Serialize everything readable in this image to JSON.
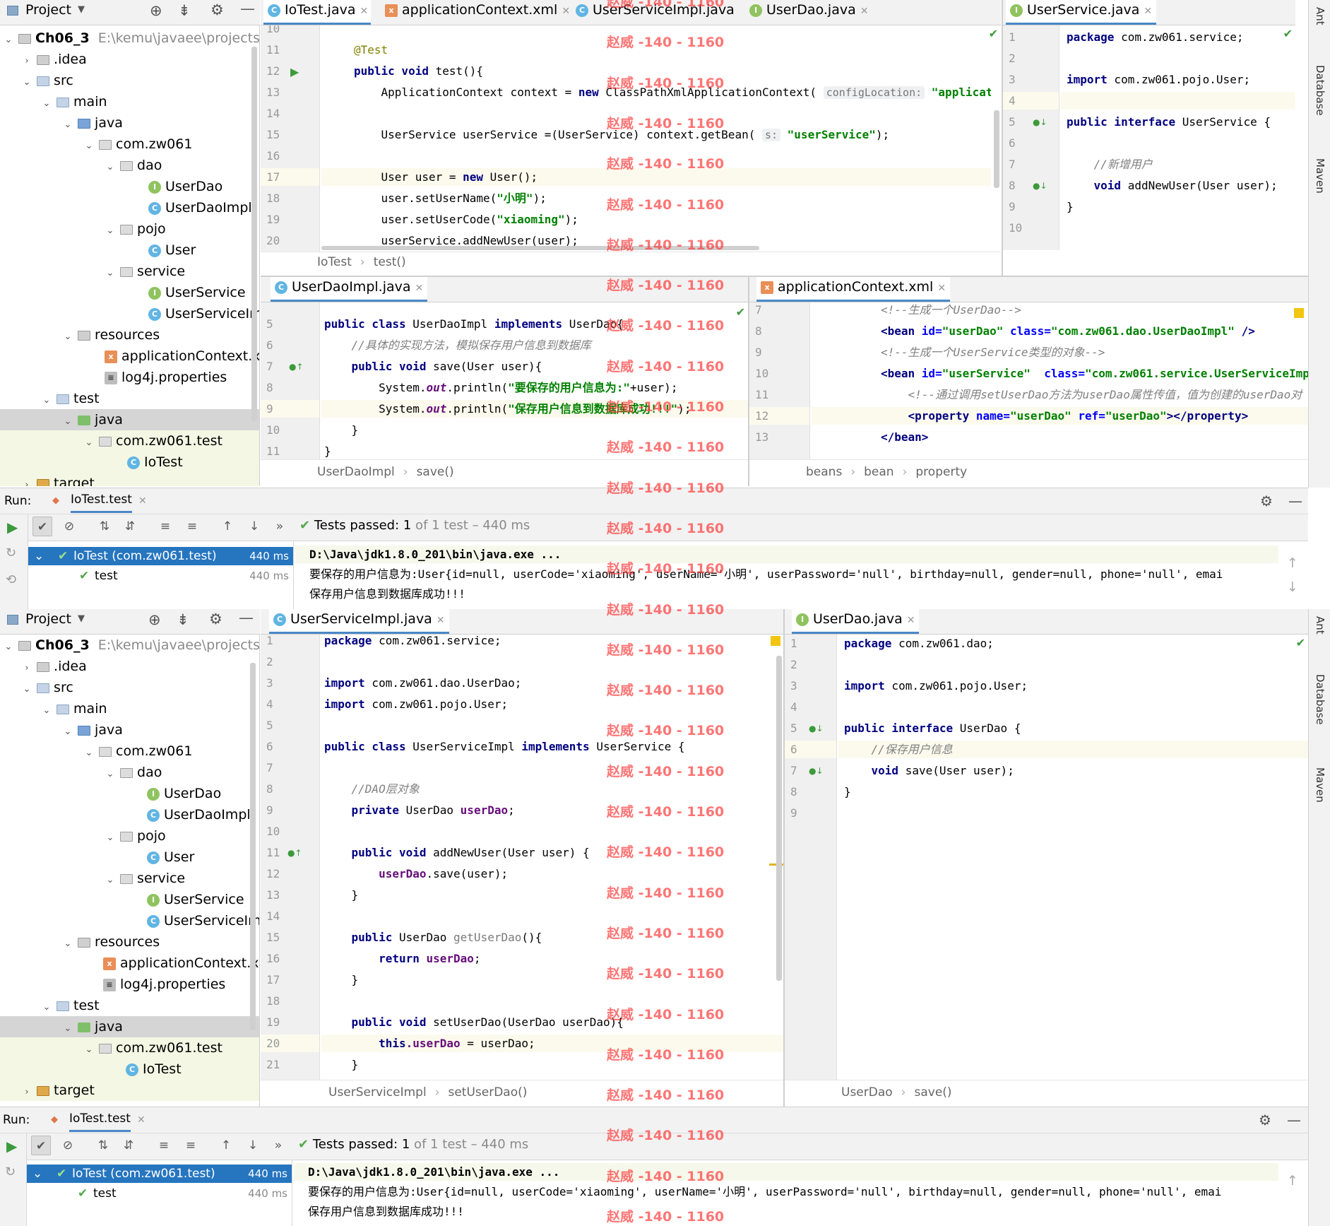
{
  "panel_top": {
    "project": {
      "title": "Project",
      "root_name": "Ch06_3",
      "root_path": "E:\\kemu\\javaee\\projects\\Ch",
      "items": [
        ".idea",
        "src",
        "main",
        "java",
        "com.zw061",
        "dao",
        "UserDao",
        "UserDaoImpl",
        "pojo",
        "User",
        "service",
        "UserService",
        "UserServiceImp",
        "resources",
        "applicationContext.xm",
        "log4j.properties",
        "test",
        "java",
        "com.zw061.test",
        "IoTest",
        "target"
      ]
    },
    "editor_tabs": [
      "IoTest.java",
      "applicationContext.xml",
      "UserServiceImpl.java",
      "UserDao.java"
    ],
    "right_tab": "UserService.java",
    "iotest_lines": {
      "nums": [
        "10",
        "11",
        "12",
        "13",
        "14",
        "15",
        "16",
        "17",
        "18",
        "19",
        "20"
      ],
      "annotation": "@Test",
      "l12_a": "public void ",
      "l12_b": "test(){",
      "l13_a": "    ApplicationContext context = ",
      "l13_kw": "new",
      "l13_b": " ClassPathXmlApplicationContext( ",
      "l13_hint": "configLocation:",
      "l13_str": " \"applicat",
      "l15_a": "    UserService userService =(UserService) context.getBean( ",
      "l15_hint": "s:",
      "l15_str": " \"userService\"",
      "l15_b": ");",
      "l17_a": "    User user = ",
      "l17_kw": "new",
      "l17_b": " User();",
      "l18_a": "    user.setUserName(",
      "l18_str": "\"小明\"",
      "l18_b": ");",
      "l19_a": "    user.setUserCode(",
      "l19_str": "\"xiaoming\"",
      "l19_b": ");",
      "l20": "    userService.addNewUser(user);"
    },
    "iotest_crumb": [
      "IoTest",
      "test()"
    ],
    "userservice_lines": {
      "nums": [
        "1",
        "2",
        "3",
        "4",
        "5",
        "6",
        "7",
        "8",
        "9",
        "10"
      ],
      "l1_kw": "package",
      "l1_b": " com.zw061.service;",
      "l3_kw": "import",
      "l3_b": " com.zw061.pojo.User;",
      "l5_kw": "public interface",
      "l5_b": " UserService {",
      "l7_cm": "    //新增用户",
      "l8_kw": "    void",
      "l8_b": " addNewUser(User user);",
      "l9": "}"
    },
    "mid_left_tab": "UserDaoImpl.java",
    "userdaoimpl_lines": {
      "nums": [
        "5",
        "6",
        "7",
        "8",
        "9",
        "10",
        "11"
      ],
      "l5_kw": "public class",
      "l5_b": " UserDaoImpl ",
      "l5_kw2": "implements",
      "l5_c": " UserDao{",
      "l6_cm": "    //具体的实现方法，模拟保存用户信息到数据库",
      "l7_kw": "    public void",
      "l7_b": " save(User user){",
      "l8_a": "        System.",
      "l8_fld": "out",
      "l8_b": ".println(",
      "l8_str": "\"要保存的用户信息为:\"",
      "l8_c": "+user);",
      "l9_a": "        System.",
      "l9_fld": "out",
      "l9_b": ".println(",
      "l9_str": "\"保存用户信息到数据库成功!!!\"",
      "l9_c": ");",
      "l10": "    }",
      "l11": "}"
    },
    "userdaoimpl_crumb": [
      "UserDaoImpl",
      "save()"
    ],
    "mid_right_tab": "applicationContext.xml",
    "xml_lines": {
      "nums": [
        "7",
        "8",
        "9",
        "10",
        "11",
        "12",
        "13"
      ],
      "l7_cm": "<!--生成一个UserDao-->",
      "l8_tag": "<bean ",
      "l8_attr1": "id=",
      "l8_v1": "\"userDao\"",
      "l8_attr2": " class=",
      "l8_v2": "\"com.zw061.dao.UserDaoImpl\"",
      "l8_end": " />",
      "l9_cm": "<!--生成一个UserService类型的对象-->",
      "l10_tag": "<bean ",
      "l10_attr1": "id=",
      "l10_v1": "\"userService\"",
      "l10_attr2": "  class=",
      "l10_v2": "\"com.zw061.service.UserServiceImpl\"",
      "l10_end": ">",
      "l11_cm": "    <!--通过调用setUserDao方法为userDao属性传值，值为创建的userDao对",
      "l12_tag": "    <property ",
      "l12_attr1": "name=",
      "l12_v1": "\"userDao\"",
      "l12_attr2": " ref=",
      "l12_v2": "\"userDao\"",
      "l12_end": "></property>",
      "l13_tag": "</bean>"
    },
    "xml_crumb": [
      "beans",
      "bean",
      "property"
    ],
    "run": {
      "label": "Run:",
      "tab": "IoTest.test",
      "status_prefix": "Tests passed: ",
      "status_count": "1",
      "status_suffix": " of 1 test – 440 ms",
      "tree": [
        {
          "name": "IoTest (com.zw061.test)",
          "time": "440 ms"
        },
        {
          "name": "test",
          "time": "440 ms"
        }
      ],
      "console": [
        "D:\\Java\\jdk1.8.0_201\\bin\\java.exe ...",
        "要保存的用户信息为:User{id=null, userCode='xiaoming', userName='小明', userPassword='null', birthday=null, gender=null, phone='null', emai",
        "保存用户信息到数据库成功!!!"
      ]
    },
    "sidebar": [
      "Ant",
      "Database",
      "Maven"
    ]
  },
  "panel_bottom": {
    "project": {
      "title": "Project",
      "root_name": "Ch06_3",
      "root_path": "E:\\kemu\\javaee\\projects\\Ch",
      "items": [
        ".idea",
        "src",
        "main",
        "java",
        "com.zw061",
        "dao",
        "UserDao",
        "UserDaoImpl",
        "pojo",
        "User",
        "service",
        "UserService",
        "UserServiceImp",
        "resources",
        "applicationContext.xm",
        "log4j.properties",
        "test",
        "java",
        "com.zw061.test",
        "IoTest",
        "target"
      ]
    },
    "left_tab": "UserServiceImpl.java",
    "right_tab": "UserDao.java",
    "usi_lines": {
      "nums": [
        "1",
        "2",
        "3",
        "4",
        "5",
        "6",
        "7",
        "8",
        "9",
        "10",
        "11",
        "12",
        "13",
        "14",
        "15",
        "16",
        "17",
        "18",
        "19",
        "20",
        "21"
      ],
      "l1_kw": "package",
      "l1_b": " com.zw061.service;",
      "l3_kw": "import",
      "l3_b": " com.zw061.dao.UserDao;",
      "l4_kw": "import",
      "l4_b": " com.zw061.pojo.User;",
      "l6_kw": "public class",
      "l6_b": " UserServiceImpl ",
      "l6_kw2": "implements",
      "l6_c": " UserService {",
      "l8_cm": "    //DAO层对象",
      "l9_kw": "    private",
      "l9_b": " UserDao ",
      "l9_fld": "userDao",
      "l9_c": ";",
      "l11_kw": "    public void",
      "l11_b": " addNewUser(User user) {",
      "l12_fld": "        userDao",
      "l12_b": ".save(user);",
      "l13": "    }",
      "l15_kw": "    public",
      "l15_b": " UserDao ",
      "l15_dim": "getUserDao",
      "l15_c": "(){",
      "l16_kw": "        return",
      "l16_fld": " userDao",
      "l16_b": ";",
      "l17": "    }",
      "l19_kw": "    public void",
      "l19_b": " setUserDao(UserDao userDao){",
      "l20_kw": "        this",
      "l20_fld": ".userDao",
      "l20_b": " = userDao;",
      "l21": "    }"
    },
    "usi_crumb": [
      "UserServiceImpl",
      "setUserDao()"
    ],
    "ud_lines": {
      "nums": [
        "1",
        "2",
        "3",
        "4",
        "5",
        "6",
        "7",
        "8",
        "9"
      ],
      "l1_kw": "package",
      "l1_b": " com.zw061.dao;",
      "l3_kw": "import",
      "l3_b": " com.zw061.pojo.User;",
      "l5_kw": "public interface",
      "l5_b": " UserDao {",
      "l6_cm": "    //保存用户信息",
      "l7_kw": "    void",
      "l7_b": " save(User user);",
      "l8": "}"
    },
    "ud_crumb": [
      "UserDao",
      "save()"
    ],
    "run": {
      "label": "Run:",
      "tab": "IoTest.test",
      "status_prefix": "Tests passed: ",
      "status_count": "1",
      "status_suffix": " of 1 test – 440 ms",
      "tree": [
        {
          "name": "IoTest (com.zw061.test)",
          "time": "440 ms"
        },
        {
          "name": "test",
          "time": "440 ms"
        }
      ],
      "console": [
        "D:\\Java\\jdk1.8.0_201\\bin\\java.exe ...",
        "要保存的用户信息为:User{id=null, userCode='xiaoming', userName='小明', userPassword='null', birthday=null, gender=null, phone='null', emai",
        "保存用户信息到数据库成功!!!"
      ]
    },
    "sidebar": [
      "Ant",
      "Database",
      "Maven"
    ]
  },
  "watermark": "赵威 -140 - 1160",
  "colors": {
    "keyword": "#000080",
    "string": "#008000",
    "comment": "#808080",
    "field": "#660e7a",
    "selection": "#2675bf",
    "watermark": "#ff3b3b"
  }
}
